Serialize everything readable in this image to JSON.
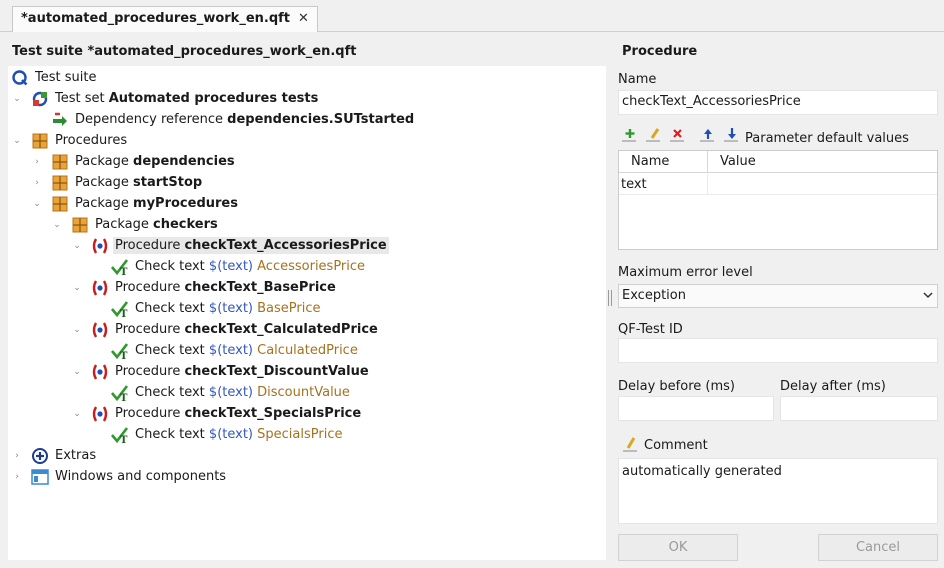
{
  "tab": {
    "label": "*automated_procedures_work_en.qft",
    "close": "✕"
  },
  "left": {
    "title": "Test suite *automated_procedures_work_en.qft"
  },
  "tree": {
    "root": "Test suite",
    "testset_prefix": "Test set ",
    "testset_name": "Automated procedures tests",
    "dep_prefix": "Dependency reference ",
    "dep_name": "dependencies.SUTstarted",
    "procedures": "Procedures",
    "pkg_prefix": "Package ",
    "pkg_dependencies": "dependencies",
    "pkg_startstop": "startStop",
    "pkg_myprocedures": "myProcedures",
    "pkg_checkers": "checkers",
    "proc_prefix": "Procedure ",
    "check_prefix": "Check text ",
    "text_var": "$(text)",
    "items": [
      {
        "proc": "checkText_AccessoriesPrice",
        "check": "AccessoriesPrice"
      },
      {
        "proc": "checkText_BasePrice",
        "check": "BasePrice"
      },
      {
        "proc": "checkText_CalculatedPrice",
        "check": "CalculatedPrice"
      },
      {
        "proc": "checkText_DiscountValue",
        "check": "DiscountValue"
      },
      {
        "proc": "checkText_SpecialsPrice",
        "check": "SpecialsPrice"
      }
    ],
    "extras": "Extras",
    "windows": "Windows and components"
  },
  "procedure": {
    "title": "Procedure",
    "name_label": "Name",
    "name_value": "checkText_AccessoriesPrice",
    "params_label": "Parameter default values",
    "col_name": "Name",
    "col_value": "Value",
    "param_rows": [
      {
        "name": "text",
        "value": ""
      }
    ],
    "max_error_label": "Maximum error level",
    "max_error_value": "Exception",
    "qfid_label": "QF-Test ID",
    "qfid_value": "",
    "delay_before_label": "Delay before (ms)",
    "delay_before_value": "",
    "delay_after_label": "Delay after (ms)",
    "delay_after_value": "",
    "comment_label": "Comment",
    "comment_value": "automatically generated",
    "ok": "OK",
    "cancel": "Cancel"
  }
}
